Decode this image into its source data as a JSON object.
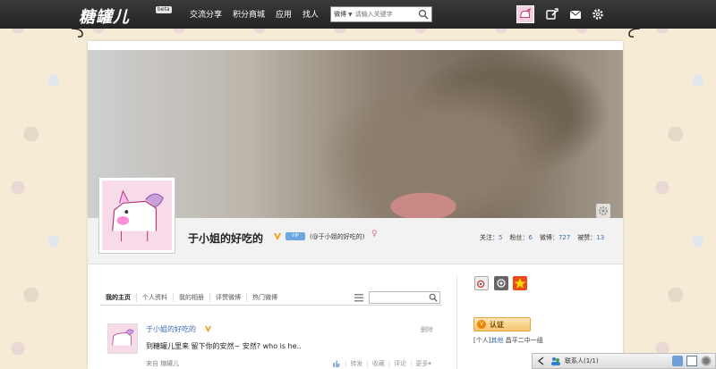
{
  "app": {
    "logo_text": "糖罐儿",
    "beta_label": "beta"
  },
  "nav": {
    "items": [
      "交流分享",
      "积分商城",
      "应用",
      "找人"
    ]
  },
  "search": {
    "type_label": "微博",
    "placeholder": "请输入关键字"
  },
  "profile": {
    "name": "于小姐的好吃的",
    "vip_label": "VIP",
    "handle": "(@于小姐的好吃的)",
    "gender_symbol": "♀",
    "stats": [
      {
        "label": "关注：",
        "value": "5"
      },
      {
        "label": "粉丝：",
        "value": "6"
      },
      {
        "label": "微博：",
        "value": "727"
      },
      {
        "label": "被赞：",
        "value": "13"
      }
    ]
  },
  "tabs": {
    "items": [
      "我的主页",
      "个人资料",
      "我的相册",
      "评赞微博",
      "热门微博"
    ],
    "active_index": 0
  },
  "post": {
    "author": "于小姐的好吃的",
    "delete_label": "删除",
    "text": "到糖罐儿里来 留下你的安然~ 安然? who is he..",
    "source": "来自 糖罐儿",
    "actions": [
      "转发",
      "收藏",
      "评论",
      "更多▾"
    ]
  },
  "sidebar": {
    "certify_label": "认证",
    "cert_prefix": "[个人]",
    "cert_link": "其他",
    "cert_suffix": " 昌平二中一组"
  },
  "contact_bar": {
    "label": "联系人(1/1)"
  },
  "colors": {
    "topbar": "#2b2b2b",
    "link": "#3b6cb2",
    "certify_orange": "#f08300",
    "gender_pink": "#e0689a"
  }
}
